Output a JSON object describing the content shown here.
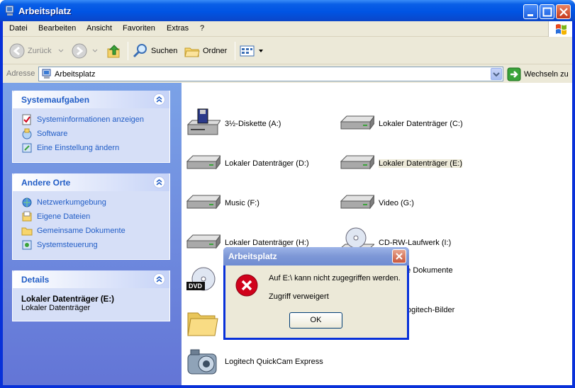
{
  "window": {
    "title": "Arbeitsplatz"
  },
  "menu": [
    "Datei",
    "Bearbeiten",
    "Ansicht",
    "Favoriten",
    "Extras",
    "?"
  ],
  "toolbar": {
    "back": "Zurück",
    "search": "Suchen",
    "folders": "Ordner"
  },
  "address": {
    "label": "Adresse",
    "value": "Arbeitsplatz",
    "go": "Wechseln zu"
  },
  "sidebar": {
    "system": {
      "title": "Systemaufgaben",
      "items": [
        "Systeminformationen anzeigen",
        "Software",
        "Eine Einstellung ändern"
      ]
    },
    "other": {
      "title": "Andere Orte",
      "items": [
        "Netzwerkumgebung",
        "Eigene Dateien",
        "Gemeinsame Dokumente",
        "Systemsteuerung"
      ]
    },
    "details": {
      "title": "Details",
      "name": "Lokaler Datenträger (E:)",
      "type": "Lokaler Datenträger"
    }
  },
  "items": [
    "3½-Diskette (A:)",
    "Lokaler Datenträger (C:)",
    "Lokaler Datenträger (D:)",
    "Lokaler Datenträger (E:)",
    "Music (F:)",
    "Video (G:)",
    "Lokaler Datenträger (H:)",
    "CD-RW-Laufwerk (I:)",
    "me Dokumente",
    "ogitech-Bilder",
    "Logitech QuickCam Express"
  ],
  "dialog": {
    "title": "Arbeitsplatz",
    "line1": "Auf E:\\ kann nicht zugegriffen werden.",
    "line2": "Zugriff verweigert",
    "ok": "OK"
  },
  "colors": {
    "title_blue": "#0054e3",
    "link_blue": "#215dc6",
    "error_red": "#d0021b"
  }
}
